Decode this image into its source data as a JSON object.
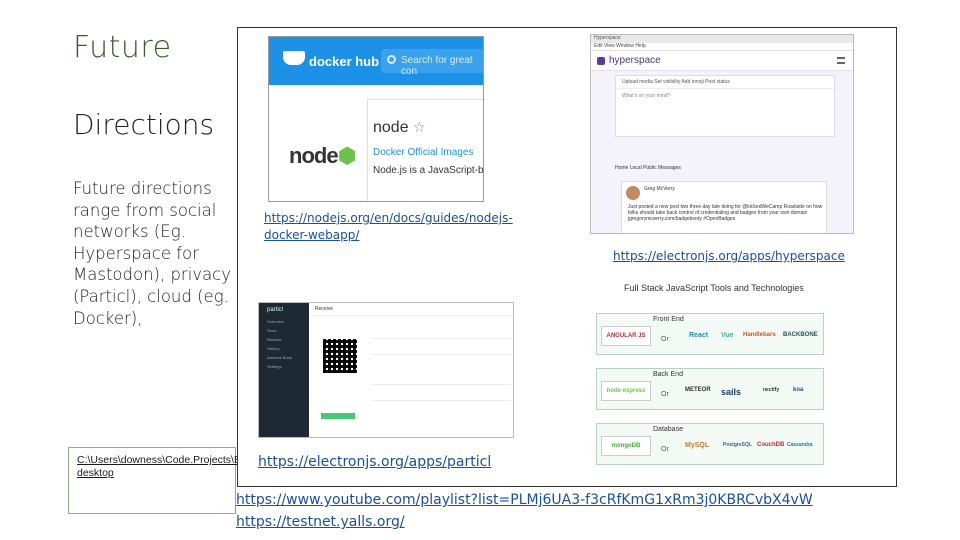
{
  "slide": {
    "title": "Future",
    "subtitle": "Directions",
    "body": "Future directions range from social networks (Eg. Hyperspace for Mastodon), privacy (Particl), cloud (eg. Docker),",
    "local_path": "C:\\Users\\downess\\Code.Projects\\Electron.Projects\\zap-desktop"
  },
  "links": {
    "nodejs_guide": "https://nodejs.org/en/docs/guides/nodejs-docker-webapp/",
    "hyperspace": "https://electronjs.org/apps/hyperspace",
    "particl": "https://electronjs.org/apps/particl",
    "youtube": "https://www.youtube.com/playlist?list=PLMj6UA3-f3cRfKmG1xRm3j0KBRCvbX4vW",
    "testnet": "https://testnet.yalls.org/"
  },
  "docker_hub": {
    "brand": "docker hub",
    "search_placeholder": "Search for great con",
    "logo_text": "node",
    "repo_name": "node",
    "badge": "Docker Official Images",
    "description": "Node.js is a JavaScript-base"
  },
  "hyperspace_app": {
    "window_title": "Hyperspace",
    "menu": "Edit   View   Window   Help",
    "brand": "hyperspace",
    "compose_toolbar": "Upload media   Set visibility   Add emoji   Post status",
    "compose_prompt": "What's on your mind?",
    "tabs": "Home   Local   Public   Messages",
    "author": "Greg McVerry",
    "post_text": "Just posted a new post two three day late doing for @kickedWeCamp Roadside on how folks should take back control of credentialing and badges from your own domain jgregorymcverry.com/badgebooty #OpenBadges"
  },
  "particl_app": {
    "brand": "particl",
    "header": "Receive",
    "sidebar_items": [
      "Overview",
      "Send",
      "Receive",
      "History",
      "Address Book",
      "Settings"
    ]
  },
  "tech_stack": {
    "title": "Full Stack JavaScript Tools and Technologies",
    "or_label": "Or",
    "rows": [
      {
        "label": "Front End",
        "first": "ANGULAR JS",
        "others": [
          "React",
          "Vue",
          "Handlebars",
          "BACKBONE"
        ]
      },
      {
        "label": "Back End",
        "first": "node express",
        "others": [
          "METEOR",
          "sails",
          "nectify",
          "koa"
        ]
      },
      {
        "label": "Database",
        "first": "mongoDB",
        "others": [
          "MySQL",
          "PostgreSQL",
          "CouchDB",
          "Cassandra"
        ]
      }
    ]
  }
}
